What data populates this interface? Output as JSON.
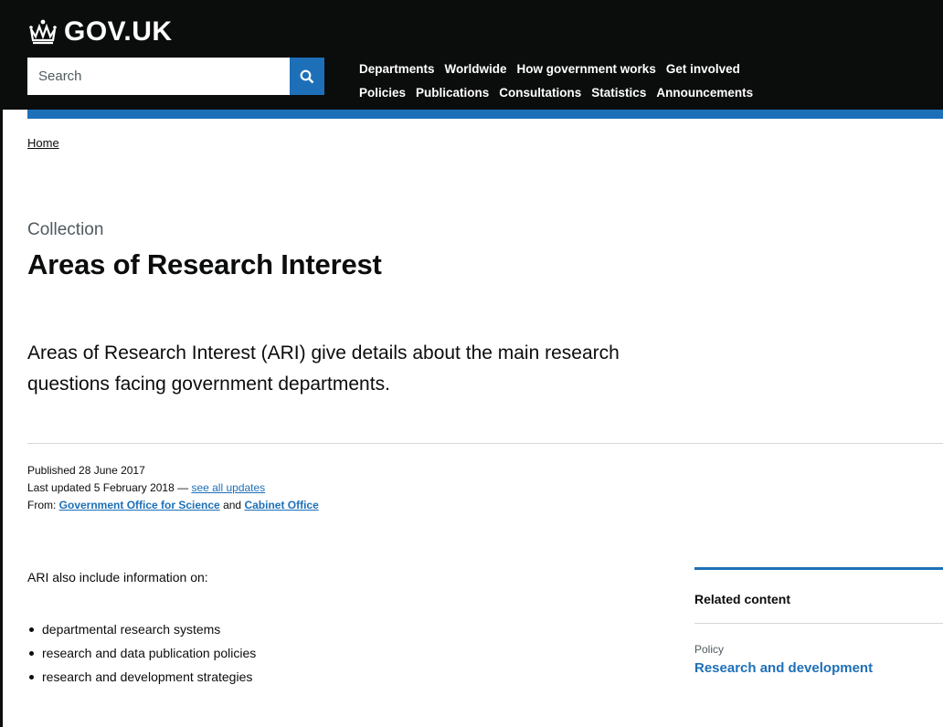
{
  "header": {
    "logo_text": "GOV.UK",
    "search_placeholder": "Search",
    "nav_row1": [
      "Departments",
      "Worldwide",
      "How government works",
      "Get involved"
    ],
    "nav_row2": [
      "Policies",
      "Publications",
      "Consultations",
      "Statistics",
      "Announcements"
    ]
  },
  "breadcrumb": {
    "home": "Home"
  },
  "page": {
    "caption": "Collection",
    "title": "Areas of Research Interest",
    "lead": "Areas of Research Interest (ARI) give details about the main research questions facing government departments."
  },
  "meta": {
    "published": "Published 28 June 2017",
    "last_updated_prefix": "Last updated 5 February 2018 — ",
    "see_all_updates": "see all updates",
    "from_prefix": "From: ",
    "org1": "Government Office for Science",
    "and": " and ",
    "org2": "Cabinet Office"
  },
  "body": {
    "intro": "ARI also include information on:",
    "bullets": [
      "departmental research systems",
      "research and data publication policies",
      "research and development strategies"
    ]
  },
  "related": {
    "heading": "Related content",
    "type": "Policy",
    "link": "Research and development"
  },
  "colors": {
    "header_bg": "#0b0c0c",
    "brand_blue": "#1d70b8",
    "text": "#0b0c0c",
    "secondary_text": "#505a5f"
  },
  "icons": {
    "logo": "crown-icon",
    "search": "search-icon"
  }
}
